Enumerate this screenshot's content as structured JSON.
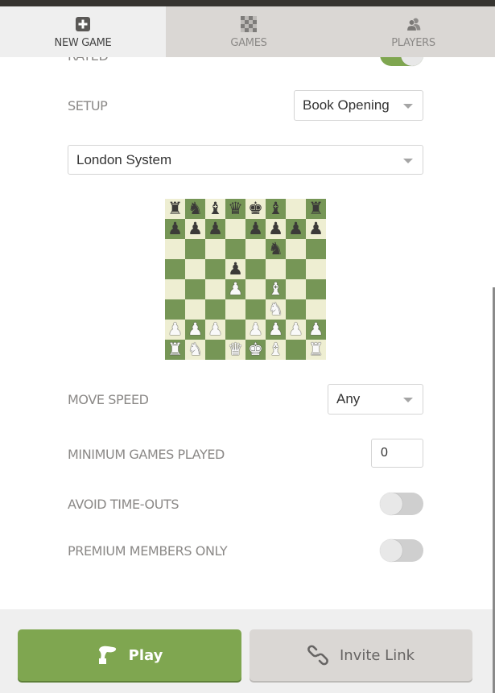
{
  "tabs": [
    {
      "label": "NEW GAME",
      "icon": "plus-square-icon",
      "active": true
    },
    {
      "label": "GAMES",
      "icon": "checkerboard-icon",
      "active": false
    },
    {
      "label": "PLAYERS",
      "icon": "users-icon",
      "active": false
    }
  ],
  "settings": {
    "rated": {
      "label": "RATED",
      "on": true
    },
    "setup": {
      "label": "SETUP",
      "value": "Book Opening"
    },
    "opening": {
      "value": "London System"
    },
    "move_speed": {
      "label": "MOVE SPEED",
      "value": "Any"
    },
    "min_games": {
      "label": "MINIMUM GAMES PLAYED",
      "value": "0"
    },
    "avoid_timeouts": {
      "label": "AVOID TIME-OUTS",
      "on": false
    },
    "premium_only": {
      "label": "PREMIUM MEMBERS ONLY",
      "on": false
    }
  },
  "board": {
    "orientation": "white",
    "ranks": [
      "rnbqkb.r",
      "ppp.pppp",
      ".....n..",
      "...p....",
      "...P.B..",
      ".....N..",
      "PPP.PPPP",
      "RN.QKB.R"
    ],
    "colors": {
      "light": "#eeeed2",
      "dark": "#769656"
    }
  },
  "actions": {
    "play_label": "Play",
    "invite_label": "Invite Link"
  },
  "colors": {
    "accent_green": "#7fa650",
    "tab_inactive": "#dad7d4",
    "tab_active": "#efefef"
  }
}
